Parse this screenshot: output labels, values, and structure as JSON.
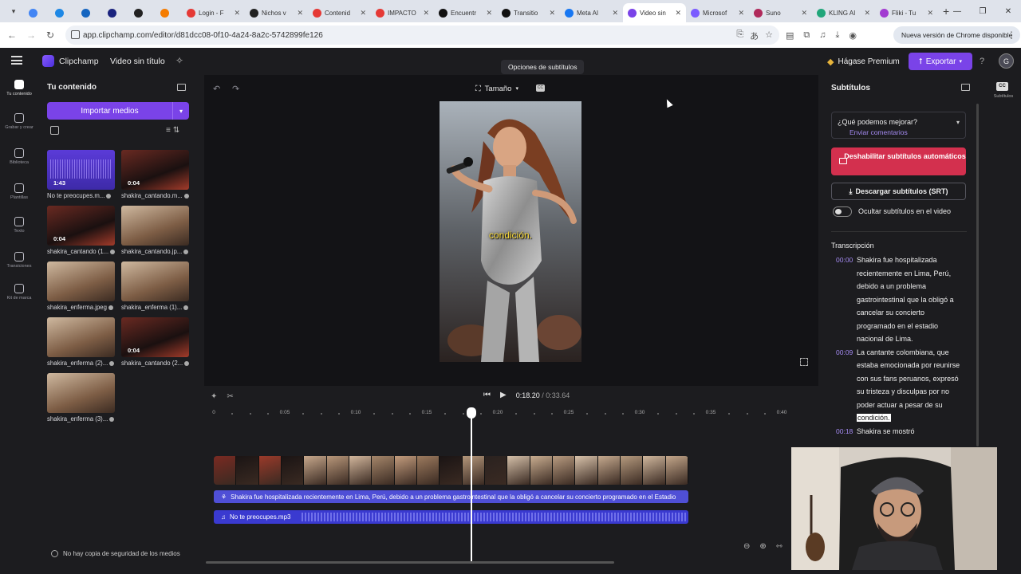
{
  "browser": {
    "tabs": [
      {
        "title": "",
        "color": "#4285f4"
      },
      {
        "title": "",
        "color": "#1e88e5"
      },
      {
        "title": "",
        "color": "#1565c0"
      },
      {
        "title": "",
        "color": "#1a237e"
      },
      {
        "title": "",
        "color": "#222222"
      },
      {
        "title": "",
        "color": "#f57c00"
      },
      {
        "title": "Login - F",
        "color": "#e53935"
      },
      {
        "title": "Nichos v",
        "color": "#222222"
      },
      {
        "title": "Contenid",
        "color": "#e53935"
      },
      {
        "title": "IMPACTO",
        "color": "#e53935"
      },
      {
        "title": "Encuentr",
        "color": "#111111"
      },
      {
        "title": "Transitio",
        "color": "#111111"
      },
      {
        "title": "Meta AI",
        "color": "#1877f2"
      },
      {
        "title": "Video sin",
        "color": "#7a43e8",
        "active": true
      },
      {
        "title": "Microsof",
        "color": "#7b5cff"
      },
      {
        "title": "Suno",
        "color": "#b02a5b"
      },
      {
        "title": "KLING AI",
        "color": "#21a67a"
      },
      {
        "title": "Fliki - Tu",
        "color": "#a23bd1"
      }
    ],
    "url": "app.clipchamp.com/editor/d81dcc08-0f10-4a24-8a2c-5742899fe126",
    "update_label": "Nueva versión de Chrome disponible"
  },
  "header": {
    "brand": "Clipchamp",
    "project_title": "Video sin título",
    "tooltip": "Opciones de subtítulos",
    "premium_label": "Hágase Premium",
    "export_label": "Exportar",
    "avatar_letter": "G"
  },
  "rail": [
    {
      "label": "Tu contenido",
      "active": true
    },
    {
      "label": "Grabar y crear"
    },
    {
      "label": "Biblioteca"
    },
    {
      "label": "Plantillas"
    },
    {
      "label": "Texto"
    },
    {
      "label": "Transiciones"
    },
    {
      "label": "Kit de marca"
    }
  ],
  "media": {
    "title": "Tu contenido",
    "import_label": "Importar medios",
    "items": [
      {
        "name": "No te preocupes.m...",
        "duration": "1:43",
        "kind": "audio"
      },
      {
        "name": "shakira_cantando.m...",
        "duration": "0:04",
        "kind": "video"
      },
      {
        "name": "shakira_cantando (1...",
        "duration": "0:04",
        "kind": "video"
      },
      {
        "name": "shakira_cantando.jp...",
        "duration": "",
        "kind": "image"
      },
      {
        "name": "shakira_enferma.jpeg",
        "duration": "",
        "kind": "image"
      },
      {
        "name": "shakira_enferma (1)...",
        "duration": "",
        "kind": "image"
      },
      {
        "name": "shakira_enferma (2)...",
        "duration": "",
        "kind": "image"
      },
      {
        "name": "shakira_cantando (2...",
        "duration": "0:04",
        "kind": "video"
      },
      {
        "name": "shakira_enferma (3)...",
        "duration": "",
        "kind": "image"
      }
    ],
    "backup_note": "No hay copia de seguridad de los medios"
  },
  "stage": {
    "size_label": "Tamaño",
    "caption": "condición."
  },
  "timeline": {
    "current_time": "0:18.20",
    "total_time": "0:33.64",
    "ruler_labels": [
      "0",
      "0:05",
      "0:10",
      "0:15",
      "0:20",
      "0:25",
      "0:30",
      "0:35",
      "0:40"
    ],
    "subtitle_track": "Shakira fue hospitalizada recientemente en Lima, Perú, debido a un problema gastrointestinal que la obligó a cancelar su concierto programado en el Estadio",
    "audio_track": "No te preocupes.mp3",
    "playhead_fraction": 0.541
  },
  "subtitles_panel": {
    "title": "Subtítulos",
    "feedback_q": "¿Qué podemos mejorar?",
    "feedback_link": "Enviar comentarios",
    "disable_label": "Deshabilitar subtítulos automáticos",
    "download_label": "Descargar subtítulos (SRT)",
    "hide_label": "Ocultar subtítulos en el video",
    "transcript_title": "Transcripción",
    "segments": [
      {
        "time": "00:00",
        "text": "Shakira fue hospitalizada recientemente en Lima, Perú, debido a un problema gastrointestinal que la obligó a cancelar su concierto programado en el estadio nacional de Lima."
      },
      {
        "time": "00:09",
        "text": "La cantante colombiana, que estaba emocionada por reunirse con sus fans peruanos, expresó su tristeza y disculpas por no poder actuar a pesar de su",
        "highlight": "condición."
      },
      {
        "time": "00:18",
        "text": "Shakira se mostró"
      }
    ]
  },
  "far_right": {
    "cc_label": "CC",
    "label": "Subtítulos"
  }
}
